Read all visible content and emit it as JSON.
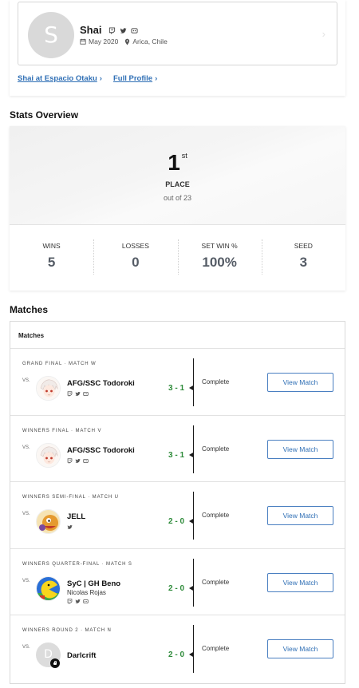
{
  "profile": {
    "avatar_letter": "S",
    "name": "Shai",
    "joined": "May 2020",
    "location": "Arica, Chile",
    "social_icons": [
      "twitch-icon",
      "twitter-icon",
      "discord-icon"
    ],
    "link_event": "Shai at Espacio Otaku",
    "link_profile": "Full Profile"
  },
  "stats": {
    "title": "Stats Overview",
    "rank": "1",
    "rank_suffix": "st",
    "place_label": "PLACE",
    "out_of": "out of 23",
    "columns": [
      {
        "label": "WINS",
        "value": "5"
      },
      {
        "label": "LOSSES",
        "value": "0"
      },
      {
        "label": "SET WIN %",
        "value": "100%"
      },
      {
        "label": "SEED",
        "value": "3"
      }
    ]
  },
  "matches": {
    "title": "Matches",
    "card_header": "Matches",
    "vs_label": "VS.",
    "button_label": "View Match",
    "rows": [
      {
        "round": "GRAND FINAL · MATCH W",
        "prefix": "AFG/SSC",
        "name": "Todoroki",
        "subtitle": "",
        "score": "3 - 1",
        "status": "Complete",
        "icons": [
          "twitch-icon",
          "twitter-icon",
          "discord-icon"
        ]
      },
      {
        "round": "WINNERS FINAL · MATCH V",
        "prefix": "AFG/SSC",
        "name": "Todoroki",
        "subtitle": "",
        "score": "3 - 1",
        "status": "Complete",
        "icons": [
          "twitch-icon",
          "twitter-icon",
          "discord-icon"
        ]
      },
      {
        "round": "WINNERS SEMI-FINAL · MATCH U",
        "prefix": "",
        "name": "JELL",
        "subtitle": "",
        "score": "2 - 0",
        "status": "Complete",
        "icons": [
          "twitter-icon"
        ]
      },
      {
        "round": "WINNERS QUARTER-FINAL · MATCH S",
        "prefix": "SyC | GH",
        "name": "Beno",
        "subtitle": "Nicolas Rojas",
        "score": "2 - 0",
        "status": "Complete",
        "icons": [
          "twitch-icon",
          "twitter-icon",
          "discord-icon"
        ]
      },
      {
        "round": "WINNERS ROUND 2 · MATCH N",
        "prefix": "",
        "name": "Darlcrift",
        "subtitle": "",
        "score": "2 - 0",
        "status": "Complete",
        "avatar_letter": "D",
        "icons": []
      }
    ]
  },
  "colors": {
    "link": "#2f6fb5",
    "score": "#2e8b3a",
    "stat_value": "#555c66"
  }
}
